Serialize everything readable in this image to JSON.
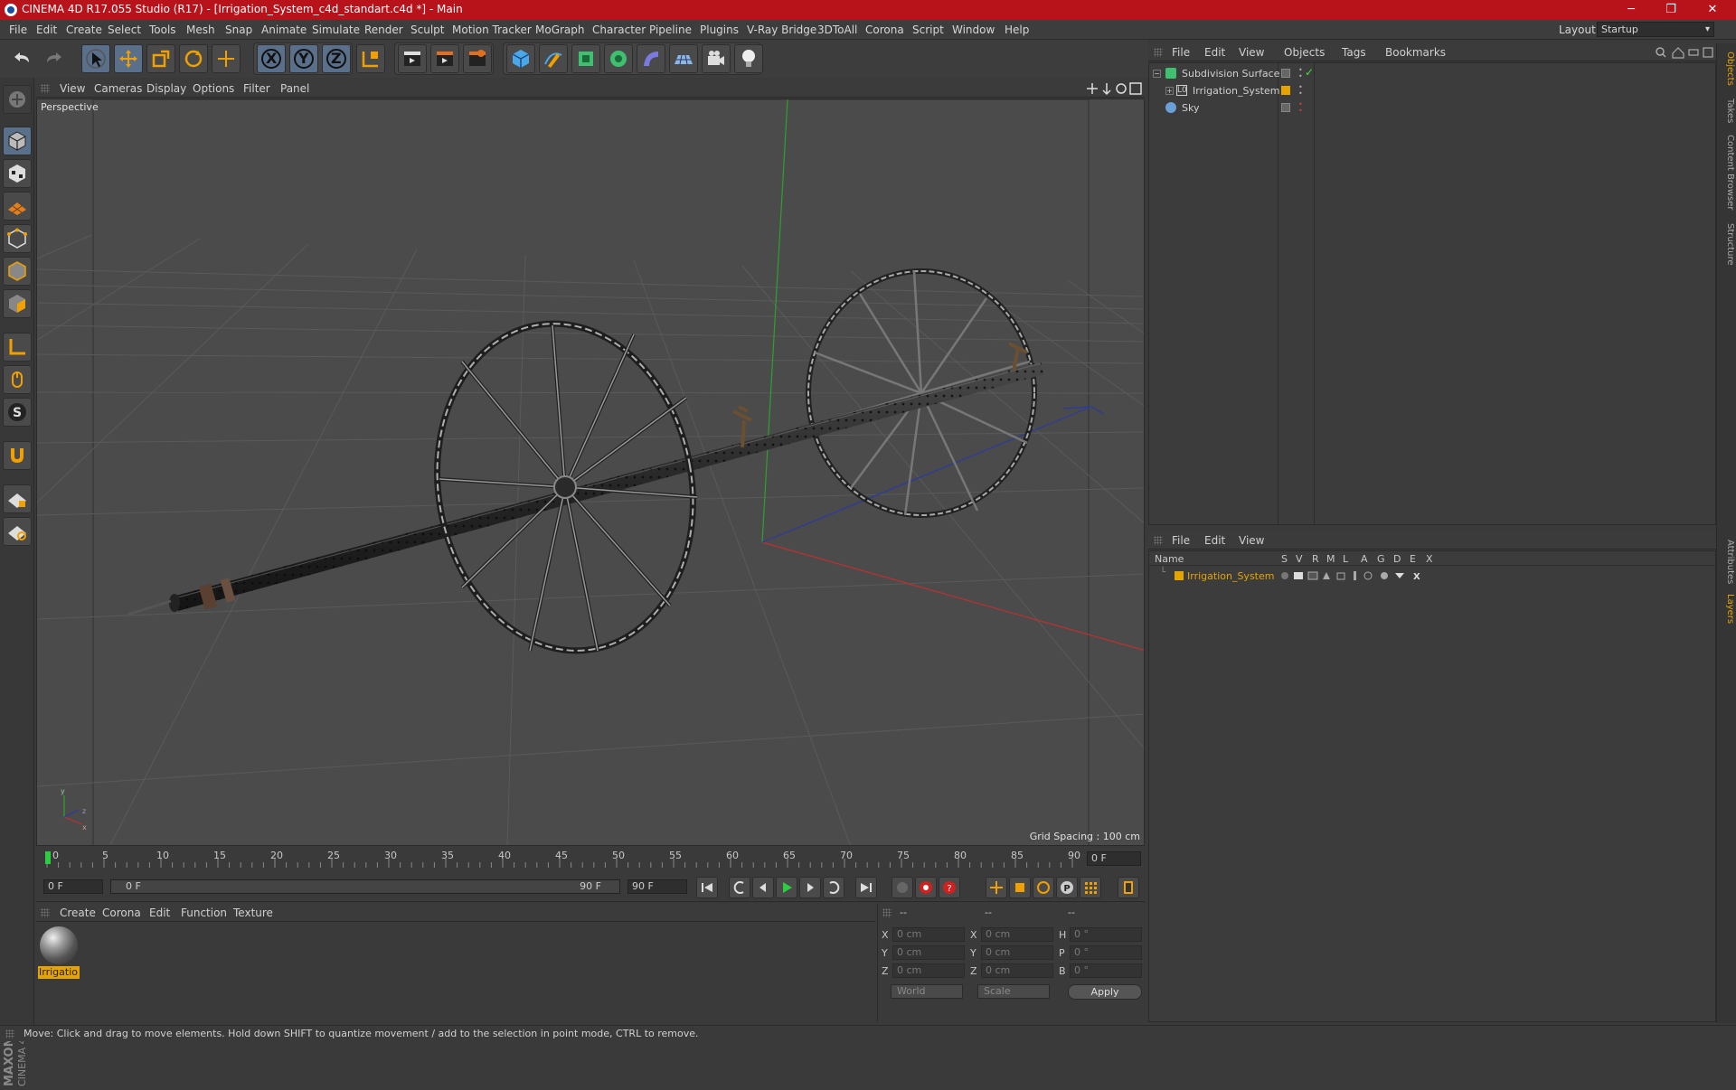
{
  "window": {
    "title": "CINEMA 4D R17.055 Studio (R17) - [Irrigation_System_c4d_standart.c4d *] - Main",
    "minimize": "─",
    "maximize": "❐",
    "close": "✕"
  },
  "menubar": {
    "items": [
      "File",
      "Edit",
      "Create",
      "Select",
      "Tools",
      "Mesh",
      "Snap",
      "Animate",
      "Simulate",
      "Render",
      "Sculpt",
      "Motion Tracker",
      "MoGraph",
      "Character",
      "Pipeline",
      "Plugins",
      "V-Ray Bridge",
      "3DToAll",
      "Corona",
      "Script",
      "Window",
      "Help"
    ],
    "layout_label": "Layout:",
    "layout_value": "Startup"
  },
  "toolbar": {
    "axis_x": "X",
    "axis_y": "Y",
    "axis_z": "Z"
  },
  "viewport": {
    "menu": [
      "View",
      "Cameras",
      "Display",
      "Options",
      "Filter",
      "Panel"
    ],
    "label": "Perspective",
    "grid_spacing": "Grid Spacing : 100 cm"
  },
  "timeline": {
    "ticks": [
      "0",
      "5",
      "10",
      "15",
      "20",
      "25",
      "30",
      "35",
      "40",
      "45",
      "50",
      "55",
      "60",
      "65",
      "70",
      "75",
      "80",
      "85",
      "90"
    ],
    "current_frame": "0 F",
    "start_field": "0 F",
    "range_start": "0 F",
    "range_end": "90 F",
    "end_field": "90 F"
  },
  "materials": {
    "menu": [
      "Create",
      "Corona",
      "Edit",
      "Function",
      "Texture"
    ],
    "items": [
      {
        "name": "Irrigatio"
      }
    ]
  },
  "coordinates": {
    "header": [
      "--",
      "--",
      "--"
    ],
    "rows": [
      {
        "a": "X",
        "av": "0 cm",
        "b": "X",
        "bv": "0 cm",
        "c": "H",
        "cv": "0 °"
      },
      {
        "a": "Y",
        "av": "0 cm",
        "b": "Y",
        "bv": "0 cm",
        "c": "P",
        "cv": "0 °"
      },
      {
        "a": "Z",
        "av": "0 cm",
        "b": "Z",
        "bv": "0 cm",
        "c": "B",
        "cv": "0 °"
      }
    ],
    "mode1": "World",
    "mode2": "Scale",
    "apply": "Apply"
  },
  "objects": {
    "menu": [
      "File",
      "Edit",
      "View",
      "Objects",
      "Tags",
      "Bookmarks"
    ],
    "items": [
      {
        "name": "Subdivision Surface",
        "color": "#3fbf6f"
      },
      {
        "name": "Irrigation_System",
        "color": "#e6a400"
      },
      {
        "name": "Sky",
        "color": "#6a9fd8"
      }
    ]
  },
  "layers": {
    "menu": [
      "File",
      "Edit",
      "View"
    ],
    "header": {
      "name": "Name",
      "cols": [
        "S",
        "V",
        "R",
        "M",
        "L",
        "A",
        "G",
        "D",
        "E",
        "X"
      ]
    },
    "items": [
      {
        "name": "Irrigation_System",
        "color": "#e6a400"
      }
    ]
  },
  "right_tabs": [
    "Objects",
    "Takes",
    "Content Browser",
    "Structure",
    "Attributes",
    "Layers"
  ],
  "status": "Move: Click and drag to move elements. Hold down SHIFT to quantize movement / add to the selection in point mode, CTRL to remove.",
  "branding": "MAXON CINEMA 4D"
}
